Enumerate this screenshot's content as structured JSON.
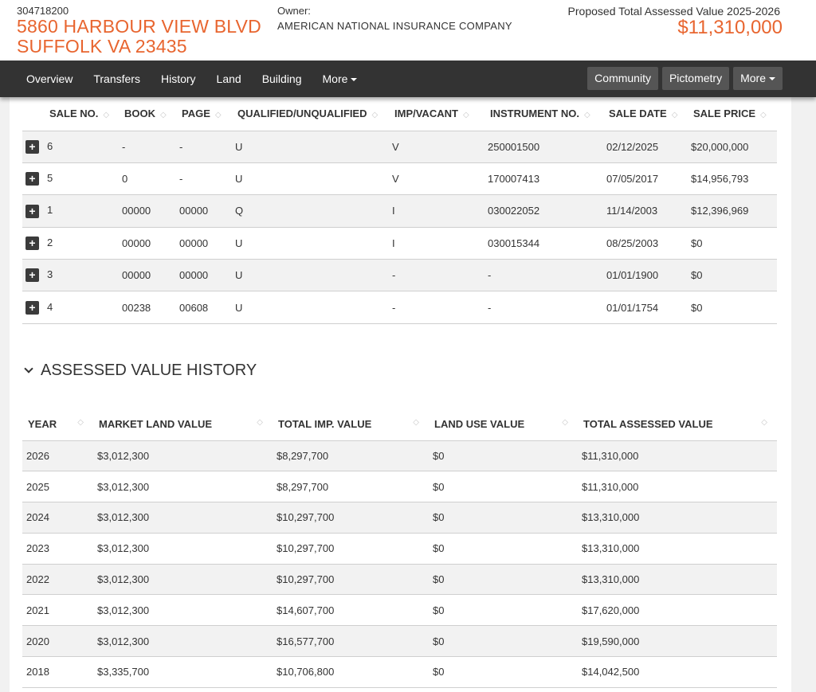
{
  "header": {
    "parcel_id": "304718200",
    "address_line1": "5860 HARBOUR VIEW BLVD",
    "address_line2": "SUFFOLK VA 23435",
    "owner_label": "Owner:",
    "owner_name": "AMERICAN NATIONAL INSURANCE COMPANY",
    "value_label": "Proposed Total Assessed Value 2025-2026",
    "value_amount": "$11,310,000"
  },
  "nav": {
    "links": [
      "Overview",
      "Transfers",
      "History",
      "Land",
      "Building"
    ],
    "more_label": "More",
    "buttons": [
      "Community",
      "Pictometry"
    ],
    "more_button_label": "More"
  },
  "sales": {
    "sort_glyph": "◇",
    "expand_glyph": "+",
    "columns": [
      "SALE NO.",
      "BOOK",
      "PAGE",
      "QUALIFIED/UNQUALIFIED",
      "IMP/VACANT",
      "INSTRUMENT NO.",
      "SALE DATE",
      "SALE PRICE"
    ],
    "rows": [
      [
        "6",
        "-",
        "-",
        "U",
        "V",
        "250001500",
        "02/12/2025",
        "$20,000,000"
      ],
      [
        "5",
        "0",
        "-",
        "U",
        "V",
        "170007413",
        "07/05/2017",
        "$14,956,793"
      ],
      [
        "1",
        "00000",
        "00000",
        "Q",
        "I",
        "030022052",
        "11/14/2003",
        "$12,396,969"
      ],
      [
        "2",
        "00000",
        "00000",
        "U",
        "I",
        "030015344",
        "08/25/2003",
        "$0"
      ],
      [
        "3",
        "00000",
        "00000",
        "U",
        "-",
        "-",
        "01/01/1900",
        "$0"
      ],
      [
        "4",
        "00238",
        "00608",
        "U",
        "-",
        "-",
        "01/01/1754",
        "$0"
      ]
    ]
  },
  "history": {
    "title": "ASSESSED VALUE HISTORY",
    "columns": [
      "YEAR",
      "MARKET LAND VALUE",
      "TOTAL IMP. VALUE",
      "LAND USE VALUE",
      "TOTAL ASSESSED VALUE"
    ],
    "rows": [
      [
        "2026",
        "$3,012,300",
        "$8,297,700",
        "$0",
        "$11,310,000"
      ],
      [
        "2025",
        "$3,012,300",
        "$8,297,700",
        "$0",
        "$11,310,000"
      ],
      [
        "2024",
        "$3,012,300",
        "$10,297,700",
        "$0",
        "$13,310,000"
      ],
      [
        "2023",
        "$3,012,300",
        "$10,297,700",
        "$0",
        "$13,310,000"
      ],
      [
        "2022",
        "$3,012,300",
        "$10,297,700",
        "$0",
        "$13,310,000"
      ],
      [
        "2021",
        "$3,012,300",
        "$14,607,700",
        "$0",
        "$17,620,000"
      ],
      [
        "2020",
        "$3,012,300",
        "$16,577,700",
        "$0",
        "$19,590,000"
      ],
      [
        "2018",
        "$3,335,700",
        "$10,706,800",
        "$0",
        "$14,042,500"
      ]
    ]
  }
}
